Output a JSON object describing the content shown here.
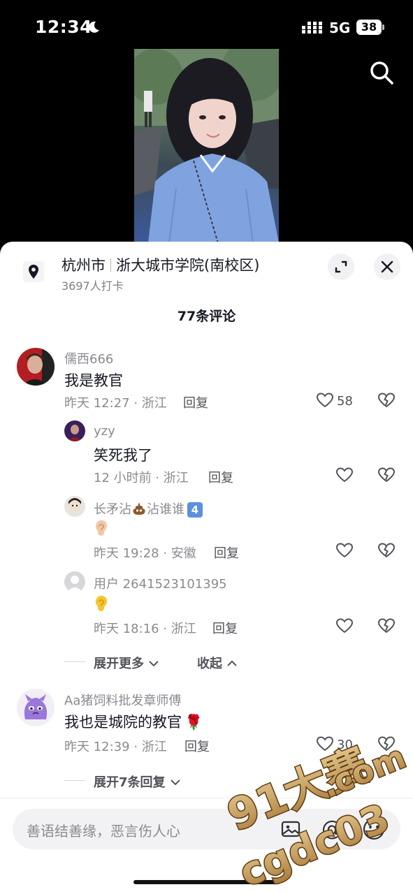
{
  "status_bar": {
    "time": "12:34",
    "network": "5G",
    "battery": "38"
  },
  "header": {
    "search_icon": "search-icon"
  },
  "location": {
    "city": "杭州市",
    "place": "浙大城市学院(南校区)",
    "checkins": "3697人打卡"
  },
  "comments_title": "77条评论",
  "comments": [
    {
      "user": "儒西666",
      "text": "我是教官",
      "time": "昨天 12:27 · 浙江",
      "reply": "回复",
      "likes": "58",
      "replies": [
        {
          "user": "yzy",
          "text": "笑死我了",
          "time": "12 小时前 · 浙江",
          "reply": "回复"
        },
        {
          "user": "长矛沾",
          "user_mid": "沾谁谁",
          "user_badge": "4",
          "text": "👂🏻",
          "time": "昨天 19:28 · 安徽",
          "reply": "回复"
        },
        {
          "user": "用户 2641523101395",
          "text": "👂",
          "time": "昨天 18:16 · 浙江",
          "reply": "回复"
        }
      ],
      "expand_more": "展开更多",
      "collapse": "收起"
    },
    {
      "user": "Aa猪饲料批发章师傅",
      "text": "我也是城院的教官",
      "text_emoji": "🌹",
      "time": "昨天 12:39 · 浙江",
      "reply": "回复",
      "likes": "30",
      "expand_replies": "展开7条回复"
    }
  ],
  "input": {
    "placeholder": "善语结善缘，恶言伤人心"
  },
  "watermark": {
    "line1": "91大赛",
    "line2": ".com",
    "line3": "cgdc03"
  }
}
